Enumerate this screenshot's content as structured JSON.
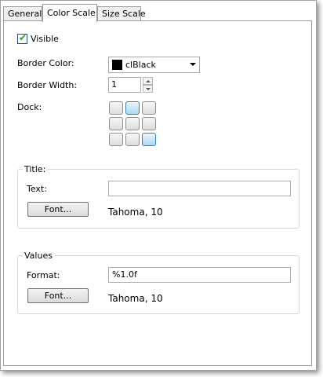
{
  "tabs": [
    {
      "label": "General",
      "active": false
    },
    {
      "label": "Color Scale",
      "active": true
    },
    {
      "label": "Size Scale",
      "active": false
    }
  ],
  "visible": {
    "label": "Visible",
    "checked": true
  },
  "border_color": {
    "label": "Border Color:",
    "value": "clBlack",
    "swatch": "#000000"
  },
  "border_width": {
    "label": "Border Width:",
    "value": "1"
  },
  "dock": {
    "label": "Dock:",
    "selected": [
      "top-center",
      "bottom-right"
    ]
  },
  "title_group": {
    "title": "Title:",
    "text_label": "Text:",
    "text_value": "",
    "font_button": "Font...",
    "font_value": "Tahoma, 10"
  },
  "values_group": {
    "title": "Values",
    "format_label": "Format:",
    "format_value": "%1.0f",
    "font_button": "Font...",
    "font_value": "Tahoma, 10"
  },
  "colors": {
    "accent": "#3c7fb1",
    "check": "#21a121"
  }
}
